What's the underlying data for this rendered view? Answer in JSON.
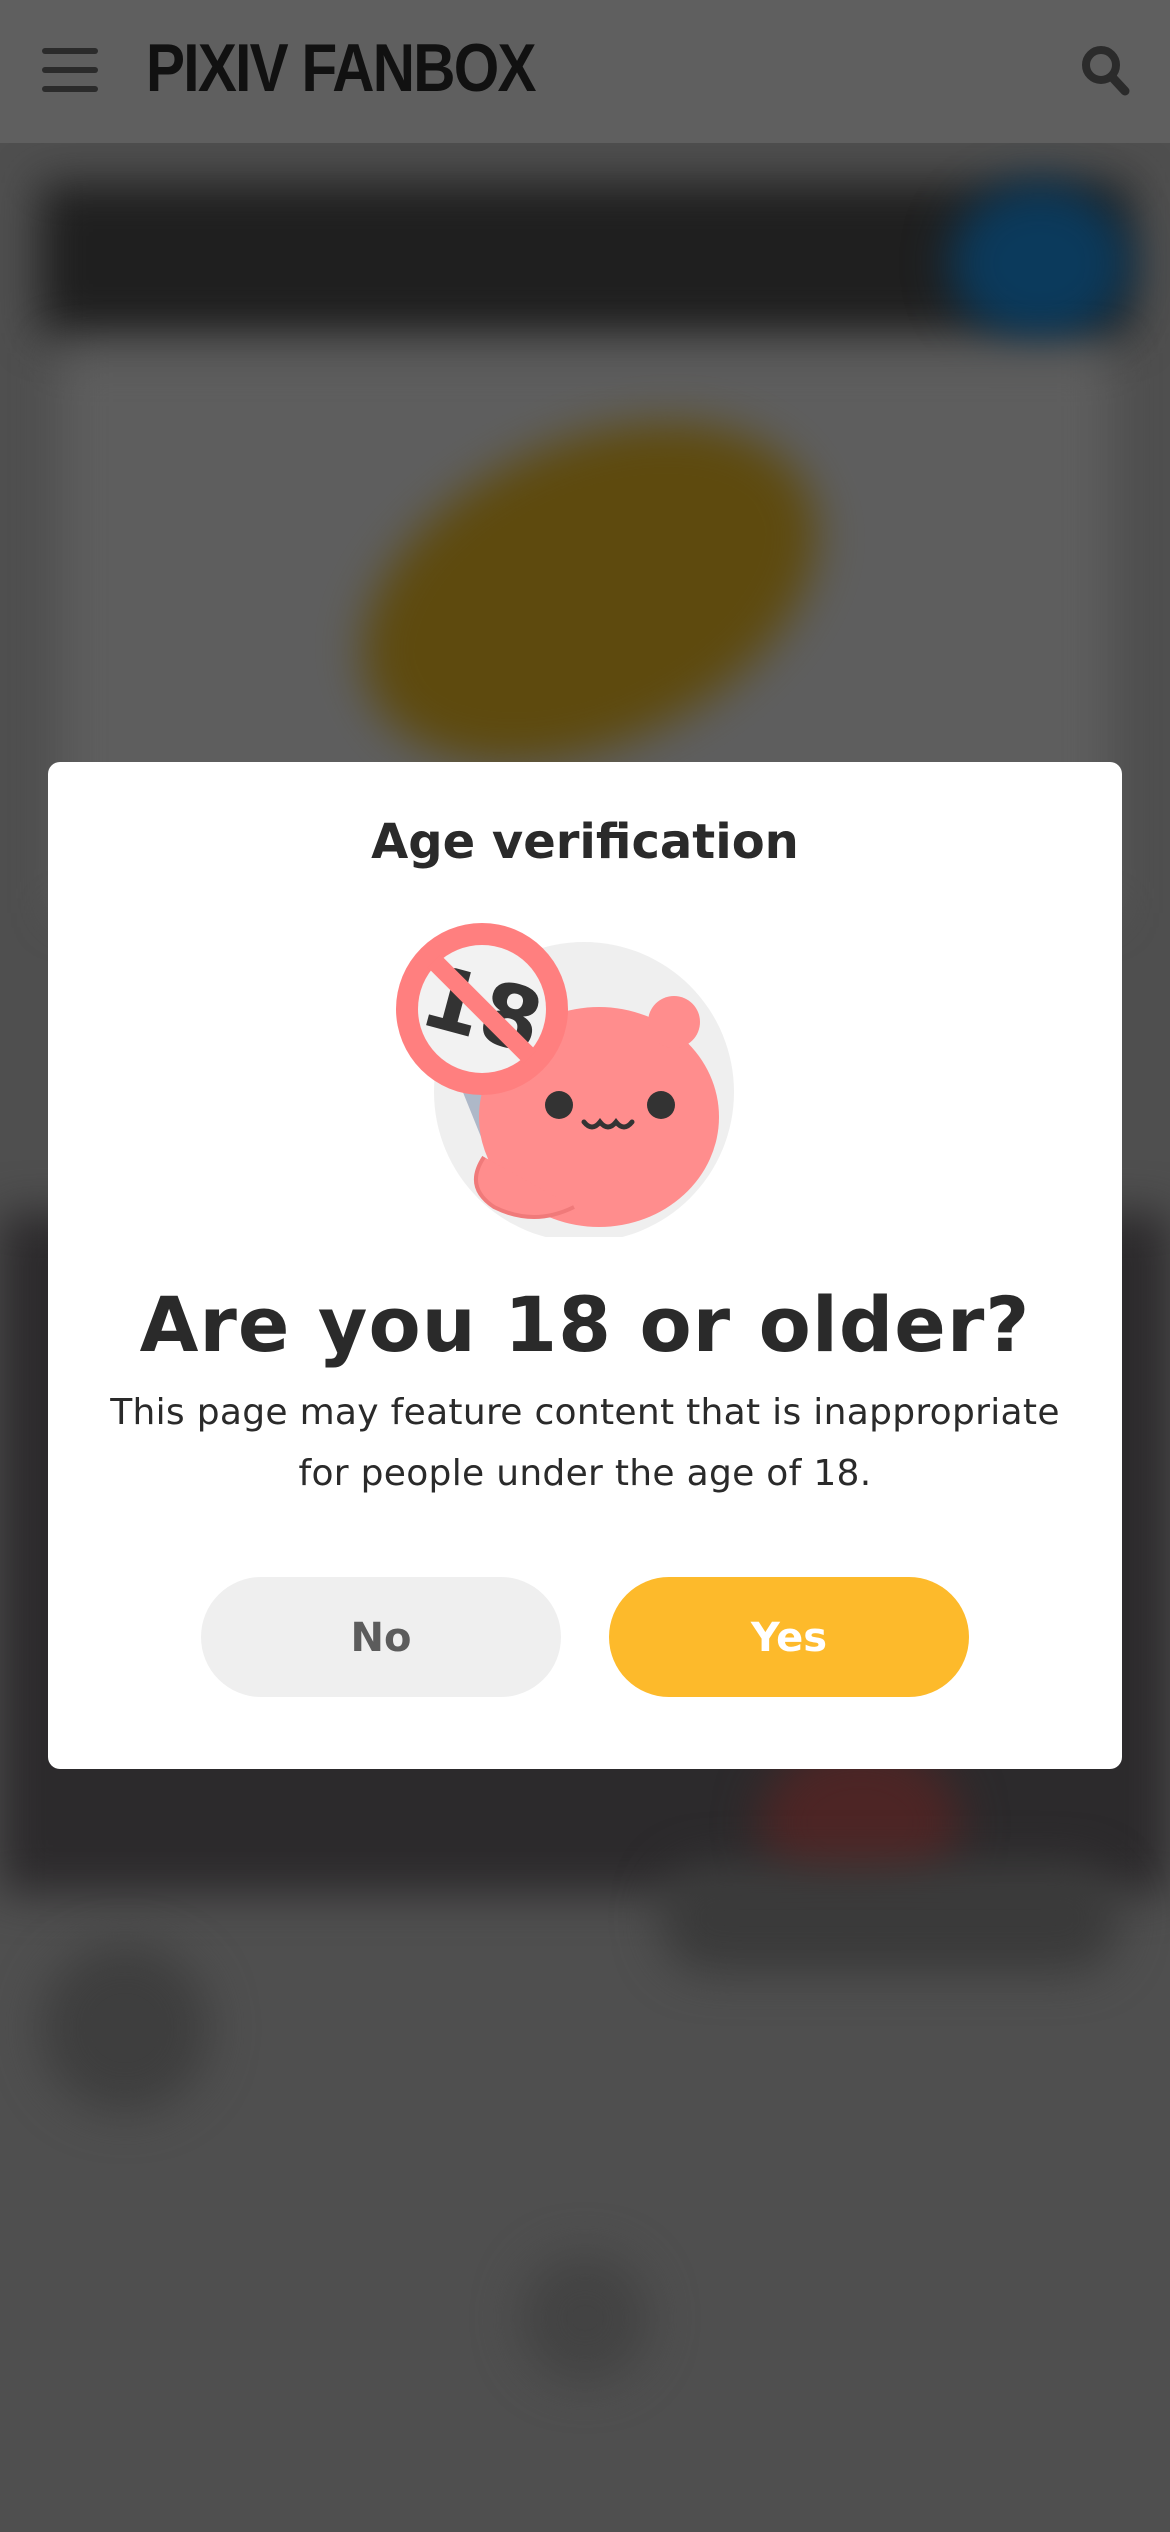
{
  "header": {
    "logo": "PIXIV FANBOX",
    "menu_icon": "hamburger-menu-icon",
    "search_icon": "search-icon"
  },
  "modal": {
    "title": "Age verification",
    "illustration": "age-restricted-mascot-illustration",
    "illustration_badge": "18",
    "question": "Are you 18 or older?",
    "description": "This page may feature content that is inappropriate for people under the age of 18.",
    "no_label": "No",
    "yes_label": "Yes"
  },
  "colors": {
    "accent_yes": "#fdba2b",
    "no_button": "#efefef",
    "overlay": "#4d4d4d",
    "mascot": "#ff8d8d"
  }
}
